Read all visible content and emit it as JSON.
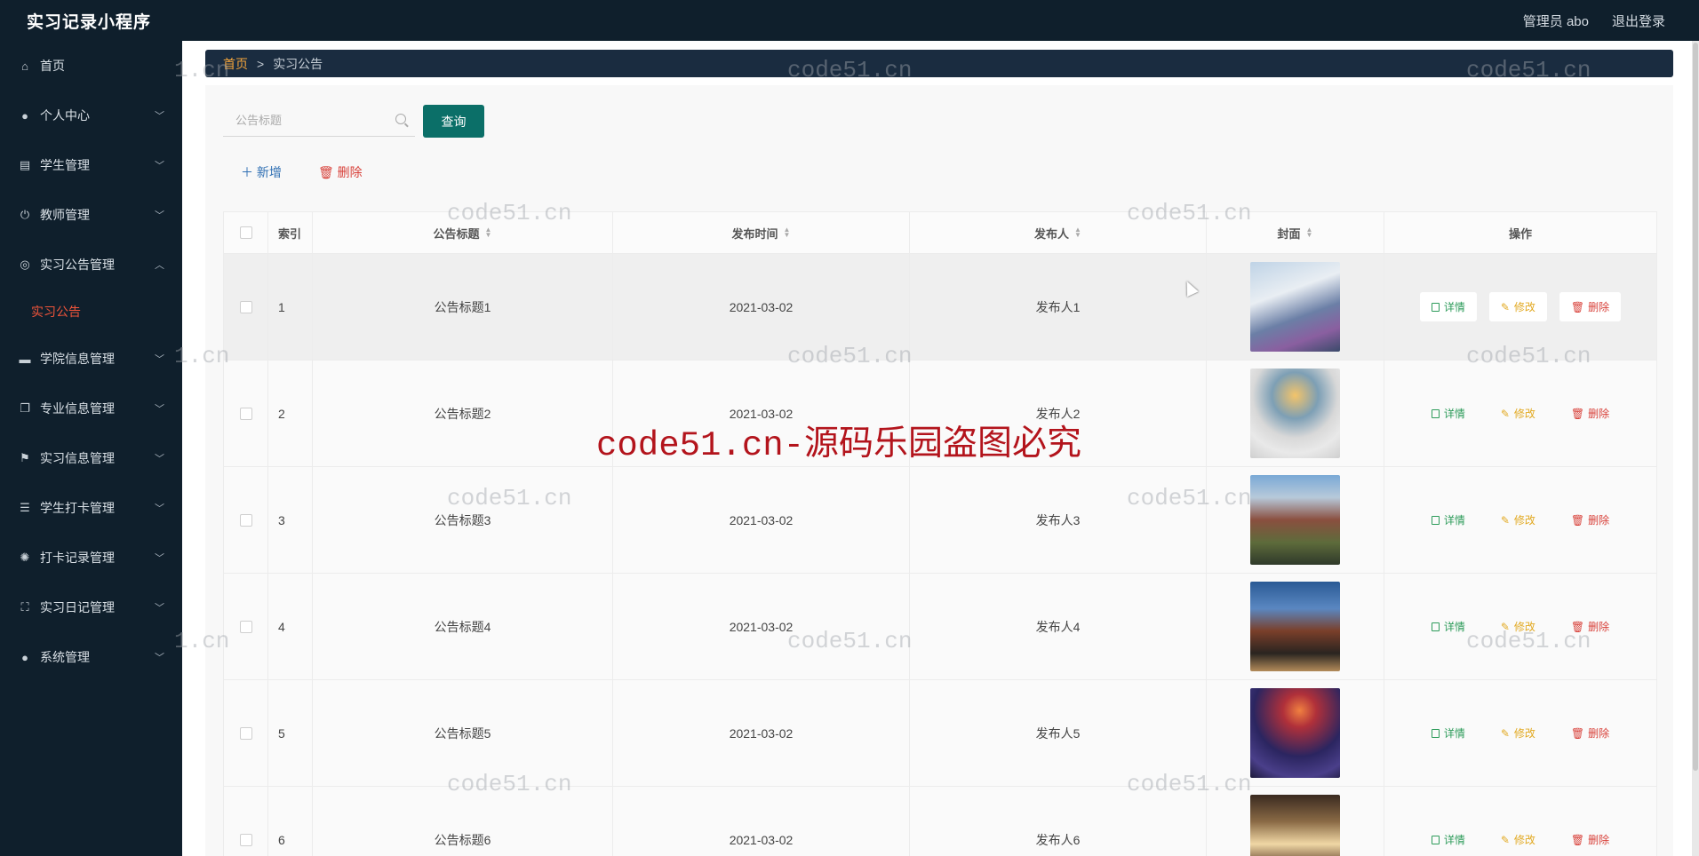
{
  "app": {
    "title": "实习记录小程序"
  },
  "header": {
    "user": "管理员 abo",
    "logout": "退出登录"
  },
  "sidebar": {
    "items": [
      {
        "label": "首页",
        "icon": "home-icon",
        "expandable": false
      },
      {
        "label": "个人中心",
        "icon": "user-icon",
        "expandable": true
      },
      {
        "label": "学生管理",
        "icon": "clipboard-icon",
        "expandable": true
      },
      {
        "label": "教师管理",
        "icon": "power-icon",
        "expandable": true
      },
      {
        "label": "实习公告管理",
        "icon": "compass-icon",
        "expandable": true,
        "expanded": true,
        "children": [
          {
            "label": "实习公告",
            "active": true
          }
        ]
      },
      {
        "label": "学院信息管理",
        "icon": "monitor-icon",
        "expandable": true
      },
      {
        "label": "专业信息管理",
        "icon": "copy-icon",
        "expandable": true
      },
      {
        "label": "实习信息管理",
        "icon": "flag-icon",
        "expandable": true
      },
      {
        "label": "学生打卡管理",
        "icon": "list-icon",
        "expandable": true
      },
      {
        "label": "打卡记录管理",
        "icon": "aperture-icon",
        "expandable": true
      },
      {
        "label": "实习日记管理",
        "icon": "fullscreen-icon",
        "expandable": true
      },
      {
        "label": "系统管理",
        "icon": "user-icon",
        "expandable": true
      }
    ]
  },
  "breadcrumb": {
    "home": "首页",
    "separator": ">",
    "current": "实习公告"
  },
  "search": {
    "placeholder": "公告标题",
    "button": "查询"
  },
  "actions": {
    "add": "新增",
    "delete": "删除"
  },
  "table": {
    "columns": [
      "索引",
      "公告标题",
      "发布时间",
      "发布人",
      "封面",
      "操作"
    ],
    "rows": [
      {
        "index": "1",
        "title": "公告标题1",
        "time": "2021-03-02",
        "publisher": "发布人1"
      },
      {
        "index": "2",
        "title": "公告标题2",
        "time": "2021-03-02",
        "publisher": "发布人2"
      },
      {
        "index": "3",
        "title": "公告标题3",
        "time": "2021-03-02",
        "publisher": "发布人3"
      },
      {
        "index": "4",
        "title": "公告标题4",
        "time": "2021-03-02",
        "publisher": "发布人4"
      },
      {
        "index": "5",
        "title": "公告标题5",
        "time": "2021-03-02",
        "publisher": "发布人5"
      },
      {
        "index": "6",
        "title": "公告标题6",
        "time": "2021-03-02",
        "publisher": "发布人6"
      }
    ],
    "ops": {
      "detail": "详情",
      "edit": "修改",
      "delete": "删除"
    }
  },
  "watermark": {
    "small": "code51.cn",
    "partial": "1.cn",
    "center": "code51.cn-源码乐园盗图必究"
  },
  "colors": {
    "sidebar_bg": "#0f1f2c",
    "accent_teal": "#0b6f68",
    "active_menu": "#f0543a",
    "detail": "#2d9b5a",
    "edit": "#e2a921",
    "delete": "#d8413a"
  }
}
